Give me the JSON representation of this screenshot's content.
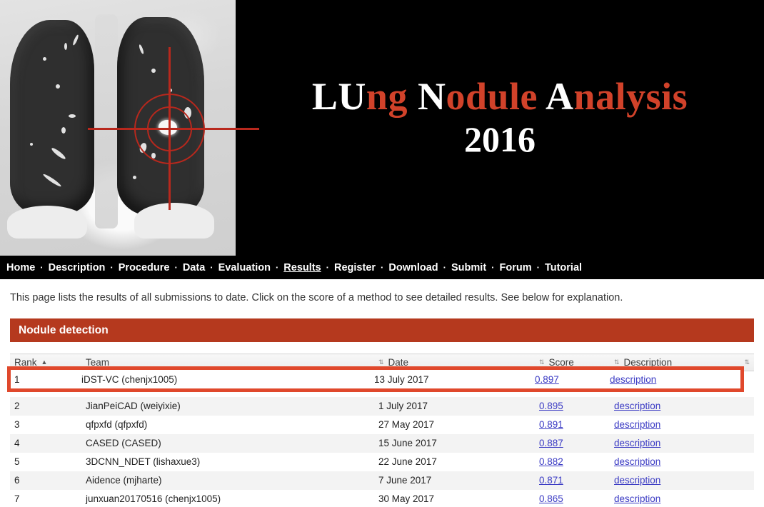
{
  "banner": {
    "title_line1_parts": [
      {
        "text": "LU",
        "color": "white"
      },
      {
        "text": "ng",
        "color": "red"
      },
      {
        "text": " ",
        "color": "white"
      },
      {
        "text": "N",
        "color": "white"
      },
      {
        "text": "odule",
        "color": "red"
      },
      {
        "text": " ",
        "color": "white"
      },
      {
        "text": "A",
        "color": "white"
      },
      {
        "text": "nalysis",
        "color": "red"
      }
    ],
    "title_line1_plain": "LUng Nodule Analysis",
    "title_line2": "2016",
    "image_name": "lung-ct-scan-with-nodule-crosshair",
    "accent_red": "#d1422a",
    "background": "#000000"
  },
  "nav": {
    "separator": "·",
    "items": [
      {
        "label": "Home",
        "active": false
      },
      {
        "label": "Description",
        "active": false
      },
      {
        "label": "Procedure",
        "active": false
      },
      {
        "label": "Data",
        "active": false
      },
      {
        "label": "Evaluation",
        "active": false
      },
      {
        "label": "Results",
        "active": true
      },
      {
        "label": "Register",
        "active": false
      },
      {
        "label": "Download",
        "active": false
      },
      {
        "label": "Submit",
        "active": false
      },
      {
        "label": "Forum",
        "active": false
      },
      {
        "label": "Tutorial",
        "active": false
      }
    ]
  },
  "main": {
    "intro": "This page lists the results of all submissions to date. Click on the score of a method to see detailed results. See below for explanation.",
    "section_title": "Nodule detection",
    "section_color": "#b5391e",
    "link_color": "#3b3bc4",
    "highlight_color": "#e0482c"
  },
  "table": {
    "columns": [
      {
        "key": "rank",
        "label": "Rank",
        "sort": "asc",
        "caret": "▲",
        "caret_position": "after"
      },
      {
        "key": "team",
        "label": "Team",
        "sort": "none",
        "caret": "",
        "caret_position": "none"
      },
      {
        "key": "date",
        "label": "Date",
        "sort": "none",
        "caret": "⇅",
        "caret_position": "before"
      },
      {
        "key": "score",
        "label": "Score",
        "sort": "none",
        "caret": "⇅",
        "caret_position": "before"
      },
      {
        "key": "description",
        "label": "Description",
        "sort": "none",
        "caret": "⇅",
        "caret_position": "before"
      }
    ],
    "tail_caret": "⇅",
    "highlighted_row": {
      "rank": "1",
      "team": "iDST-VC (chenjx1005)",
      "date": "13 July 2017",
      "score": "0.897",
      "description": "description"
    },
    "rows": [
      {
        "rank": "2",
        "team": "JianPeiCAD (weiyixie)",
        "date": "1 July 2017",
        "score": "0.895",
        "description": "description"
      },
      {
        "rank": "3",
        "team": "qfpxfd (qfpxfd)",
        "date": "27 May 2017",
        "score": "0.891",
        "description": "description"
      },
      {
        "rank": "4",
        "team": "CASED (CASED)",
        "date": "15 June 2017",
        "score": "0.887",
        "description": "description"
      },
      {
        "rank": "5",
        "team": "3DCNN_NDET (lishaxue3)",
        "date": "22 June 2017",
        "score": "0.882",
        "description": "description"
      },
      {
        "rank": "6",
        "team": "Aidence (mjharte)",
        "date": "7 June 2017",
        "score": "0.871",
        "description": "description"
      },
      {
        "rank": "7",
        "team": "junxuan20170516 (chenjx1005)",
        "date": "30 May 2017",
        "score": "0.865",
        "description": "description"
      }
    ]
  }
}
